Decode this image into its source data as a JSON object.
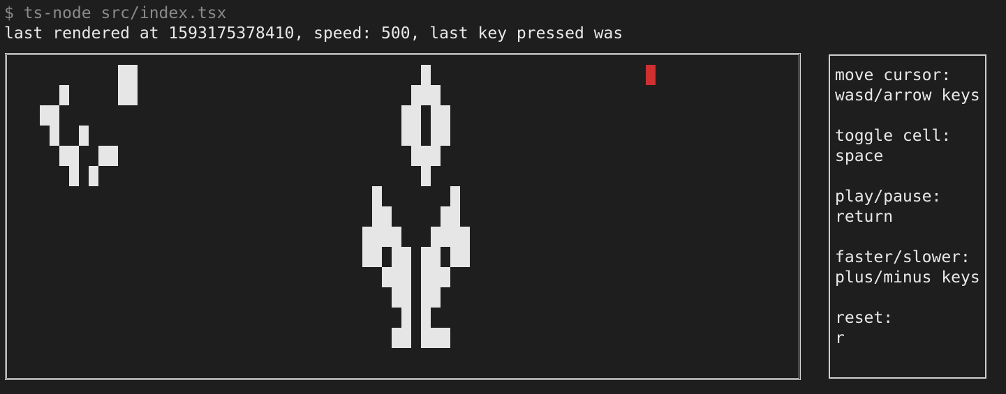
{
  "terminal": {
    "prompt_line": "$ ts-node src/index.tsx",
    "status_line": "last rendered at 1593175378410, speed: 500, last key pressed was"
  },
  "board": {
    "live_color": "#e6e6e6",
    "cursor_color": "#d0302f"
  },
  "help": {
    "sections": [
      {
        "title": "move cursor:",
        "keys": "wasd/arrow keys"
      },
      {
        "title": "toggle cell:",
        "keys": "space"
      },
      {
        "title": "play/pause:",
        "keys": "return"
      },
      {
        "title": "faster/slower:",
        "keys": "plus/minus keys"
      },
      {
        "title": "reset:",
        "keys": "r"
      }
    ]
  }
}
